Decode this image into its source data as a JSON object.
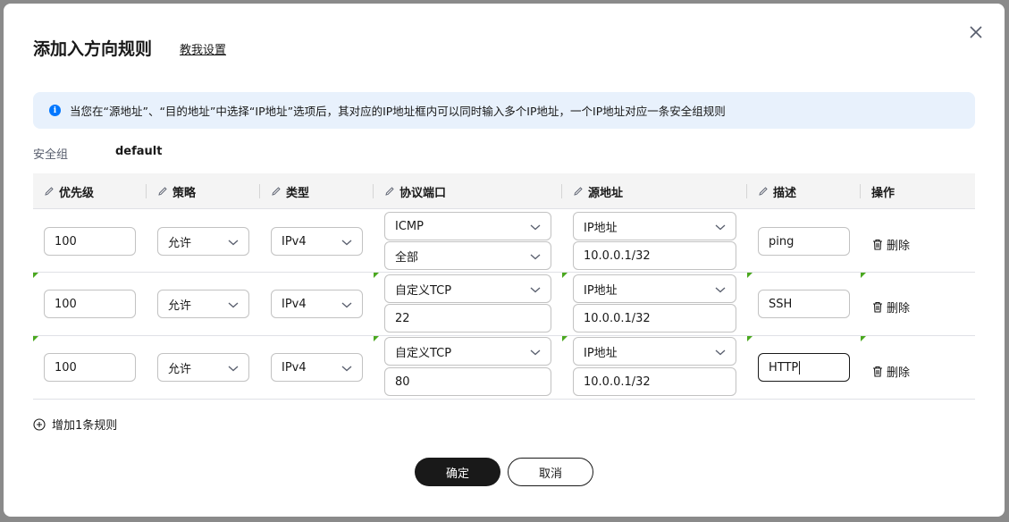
{
  "dialog": {
    "title": "添加入方向规则",
    "help_link": "教我设置",
    "notice": "当您在“源地址”、“目的地址”中选择“IP地址”选项后，其对应的IP地址框内可以同时输入多个IP地址，一个IP地址对应一条安全组规则",
    "security_group_label": "安全组",
    "security_group_value": "default"
  },
  "table": {
    "headers": {
      "priority": "优先级",
      "policy": "策略",
      "type": "类型",
      "protocol_port": "协议端口",
      "source": "源地址",
      "description": "描述",
      "actions": "操作"
    },
    "rows": [
      {
        "priority": "100",
        "policy": "允许",
        "type": "IPv4",
        "protocol": "ICMP",
        "port": "全部",
        "source_type": "IP地址",
        "source_ip": "10.0.0.1/32",
        "description": "ping",
        "delete": "删除"
      },
      {
        "priority": "100",
        "policy": "允许",
        "type": "IPv4",
        "protocol": "自定义TCP",
        "port": "22",
        "source_type": "IP地址",
        "source_ip": "10.0.0.1/32",
        "description": "SSH",
        "delete": "删除"
      },
      {
        "priority": "100",
        "policy": "允许",
        "type": "IPv4",
        "protocol": "自定义TCP",
        "port": "80",
        "source_type": "IP地址",
        "source_ip": "10.0.0.1/32",
        "description": "HTTP",
        "delete": "删除"
      }
    ]
  },
  "add_rule": "增加1条规则",
  "buttons": {
    "ok": "确定",
    "cancel": "取消"
  },
  "icons": {
    "close": "close-icon",
    "info": "info-icon",
    "edit": "pencil-icon",
    "dropdown": "chevron-down-icon",
    "delete": "trash-icon",
    "add": "plus-circle-icon"
  },
  "colors": {
    "primary": "#191919",
    "notice_bg": "#e8f1fc",
    "info": "#0077ff",
    "modified_marker": "#4aa81f"
  }
}
